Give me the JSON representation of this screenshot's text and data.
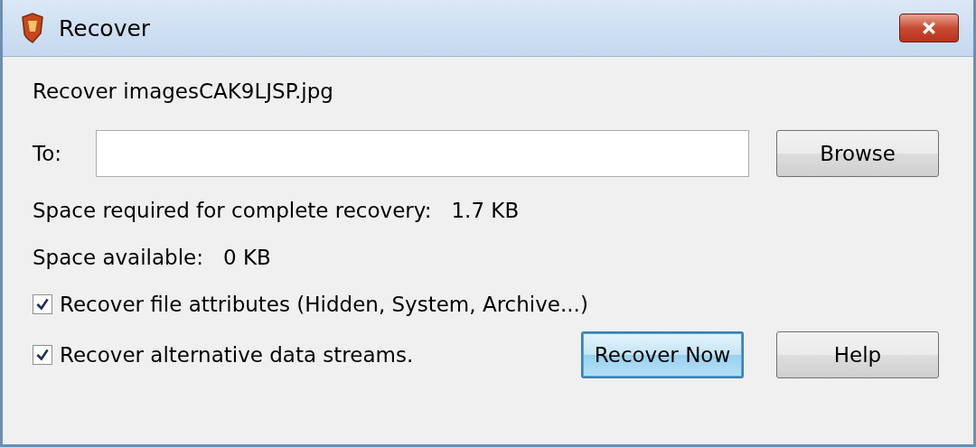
{
  "window": {
    "title": "Recover"
  },
  "heading": "Recover imagesCAK9LJSP.jpg",
  "destination": {
    "label": "To:"
  },
  "browse_button": "Browse",
  "space_required": {
    "label": "Space required for complete recovery:",
    "value": "1.7 KB"
  },
  "space_available": {
    "label": "Space available:",
    "value": "0 KB"
  },
  "options": [
    {
      "label": "Recover file attributes (Hidden, System, Archive...)",
      "checked": true
    },
    {
      "label": "Recover alternative data streams.",
      "checked": true
    }
  ],
  "buttons": [
    {
      "label": "Recover Now",
      "selected": true
    },
    {
      "label": "Help",
      "selected": false
    }
  ]
}
